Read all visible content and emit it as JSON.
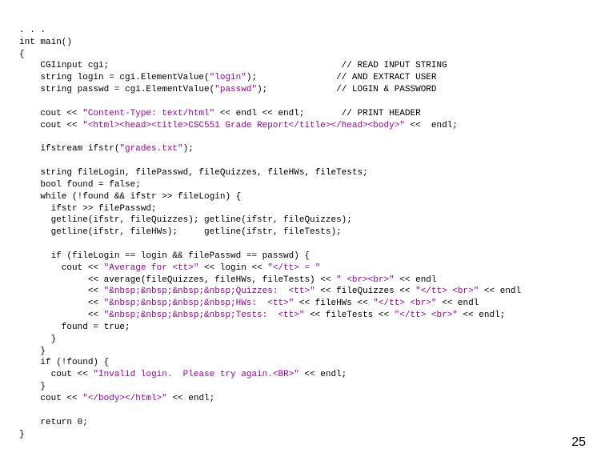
{
  "page_number": "25",
  "code": {
    "l01_a": ". . .",
    "l02_a": "int main()",
    "l03_a": "{",
    "l04_a": "    CGIinput cgi;                                            ",
    "l04_c": "// READ INPUT STRING",
    "l05_a": "    string login = cgi.ElementValue(",
    "l05_s": "\"login\"",
    "l05_b": ");               ",
    "l05_c": "// AND EXTRACT USER",
    "l06_a": "    string passwd = cgi.ElementValue(",
    "l06_s": "\"passwd\"",
    "l06_b": ");             ",
    "l06_c": "// LOGIN & PASSWORD",
    "l07_a": "",
    "l08_a": "    cout << ",
    "l08_s": "\"Content-Type: text/html\"",
    "l08_b": " << endl << endl;       ",
    "l08_c": "// PRINT HEADER",
    "l09_a": "    cout << ",
    "l09_s": "\"<html><head><title>CSC551 Grade Report</title></head><body>\"",
    "l09_b": " <<  endl;",
    "l10_a": "",
    "l11_a": "    ifstream ifstr(",
    "l11_s": "\"grades.txt\"",
    "l11_b": ");",
    "l12_a": "",
    "l13_a": "    string fileLogin, filePasswd, fileQuizzes, fileHWs, fileTests;",
    "l14_a": "    bool found = false;",
    "l15_a": "    while (!found && ifstr >> fileLogin) {",
    "l16_a": "      ifstr >> filePasswd;",
    "l17_a": "      getline(ifstr, fileQuizzes); getline(ifstr, fileQuizzes);",
    "l18_a": "      getline(ifstr, fileHWs);     getline(ifstr, fileTests);",
    "l19_a": "",
    "l20_a": "      if (fileLogin == login && filePasswd == passwd) {",
    "l21_a": "        cout << ",
    "l21_s": "\"Average for <tt>\"",
    "l21_b": " << login << ",
    "l21_s2": "\"</tt> = \"",
    "l22_a": "             << average(fileQuizzes, fileHWs, fileTests) << ",
    "l22_s": "\" <br><br>\"",
    "l22_b": " << endl",
    "l23_a": "             << ",
    "l23_s": "\"&nbsp;&nbsp;&nbsp;&nbsp;Quizzes:  <tt>\"",
    "l23_b": " << fileQuizzes << ",
    "l23_s2": "\"</tt> <br>\"",
    "l23_c": " << endl",
    "l24_a": "             << ",
    "l24_s": "\"&nbsp;&nbsp;&nbsp;&nbsp;HWs:  <tt>\"",
    "l24_b": " << fileHWs << ",
    "l24_s2": "\"</tt> <br>\"",
    "l24_c": " << endl",
    "l25_a": "             << ",
    "l25_s": "\"&nbsp;&nbsp;&nbsp;&nbsp;Tests:  <tt>\"",
    "l25_b": " << fileTests << ",
    "l25_s2": "\"</tt> <br>\"",
    "l25_c": " << endl;",
    "l26_a": "        found = true;",
    "l27_a": "      }",
    "l28_a": "    }",
    "l29_a": "    if (!found) {",
    "l30_a": "      cout << ",
    "l30_s": "\"Invalid login.  Please try again.<BR>\"",
    "l30_b": " << endl;",
    "l31_a": "    }",
    "l32_a": "    cout << ",
    "l32_s": "\"</body></html>\"",
    "l32_b": " << endl;",
    "l33_a": "",
    "l34_a": "    return 0;",
    "l35_a": "}"
  }
}
